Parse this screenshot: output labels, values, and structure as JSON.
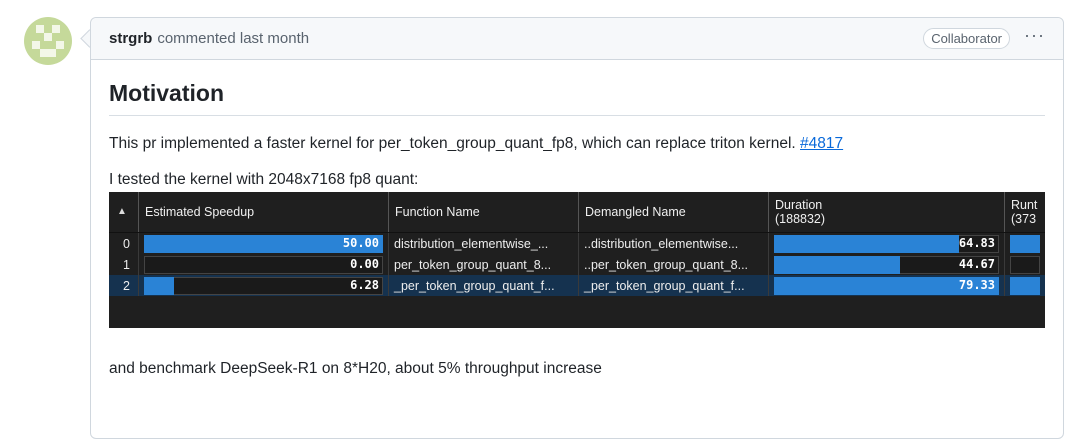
{
  "comment": {
    "author": "strgrb",
    "action": "commented last month",
    "role_badge": "Collaborator",
    "more_label": "···"
  },
  "body": {
    "heading": "Motivation",
    "paragraph1_text": "This pr implemented a faster kernel for per_token_group_quant_fp8, which can replace triton kernel. ",
    "paragraph1_link": "#4817",
    "paragraph2": "I tested the kernel with 2048x7168 fp8 quant:",
    "paragraph3": "and benchmark DeepSeek-R1 on 8*H20, about 5% throughput increase"
  },
  "table": {
    "sort_icon": "▲",
    "columns": [
      "Estimated Speedup",
      "Function Name",
      "Demangled Name",
      "Duration\n(188832)",
      "Runt\n(373"
    ],
    "rows": [
      {
        "index": "0",
        "speedup": "50.00",
        "speedup_frac": 1.0,
        "function": "distribution_elementwise_...",
        "demangled": "..distribution_elementwise...",
        "duration": "64.83",
        "duration_frac": 0.82
      },
      {
        "index": "1",
        "speedup": "0.00",
        "speedup_frac": 0.0,
        "function": "per_token_group_quant_8...",
        "demangled": "..per_token_group_quant_8...",
        "duration": "44.67",
        "duration_frac": 0.56
      },
      {
        "index": "2",
        "speedup": "6.28",
        "speedup_frac": 0.126,
        "function": "_per_token_group_quant_f...",
        "demangled": "_per_token_group_quant_f...",
        "duration": "79.33",
        "duration_frac": 1.0
      }
    ]
  },
  "colors": {
    "bar": "#2a83d6",
    "link": "#0969da",
    "selected_row": "#15324f"
  }
}
